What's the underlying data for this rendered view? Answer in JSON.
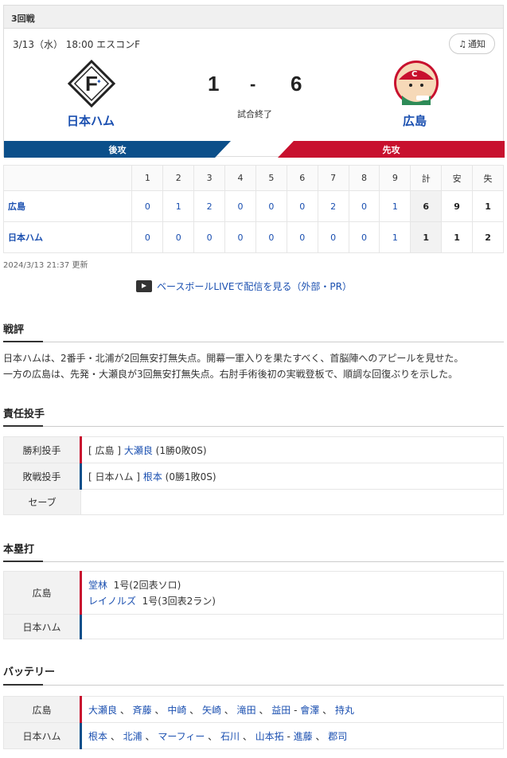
{
  "game": {
    "round": "3回戦",
    "date_venue": "3/13（水） 18:00 エスコンF",
    "notify_label": "通知",
    "home": {
      "name": "日本ハム",
      "score": "1",
      "side": "後攻"
    },
    "away": {
      "name": "広島",
      "score": "6",
      "side": "先攻"
    },
    "dash": "-",
    "status": "試合終了"
  },
  "colors": {
    "home": "#0b4f8a",
    "away": "#c8102e",
    "link": "#1a4fb0"
  },
  "scoreboard": {
    "headers": [
      "1",
      "2",
      "3",
      "4",
      "5",
      "6",
      "7",
      "8",
      "9",
      "計",
      "安",
      "失"
    ],
    "rows": [
      {
        "team": "広島",
        "innings": [
          "0",
          "1",
          "2",
          "0",
          "0",
          "0",
          "2",
          "0",
          "1"
        ],
        "total": "6",
        "hits": "9",
        "errors": "1"
      },
      {
        "team": "日本ハム",
        "innings": [
          "0",
          "0",
          "0",
          "0",
          "0",
          "0",
          "0",
          "0",
          "1"
        ],
        "total": "1",
        "hits": "1",
        "errors": "2"
      }
    ],
    "updated": "2024/3/13 21:37 更新"
  },
  "live_link": "ベースボールLIVEで配信を見る（外部・PR）",
  "review": {
    "title": "戦評",
    "line1": "日本ハムは、2番手・北浦が2回無安打無失点。開幕一軍入りを果たすべく、首脳陣へのアピールを見せた。",
    "line2": "一方の広島は、先発・大瀬良が3回無安打無失点。右肘手術後初の実戦登板で、順調な回復ぶりを示した。"
  },
  "pitchers": {
    "title": "責任投手",
    "win": {
      "label": "勝利投手",
      "team": "[ 広島 ]",
      "name": "大瀬良",
      "record": "(1勝0敗0S)"
    },
    "lose": {
      "label": "敗戦投手",
      "team": "[ 日本ハム ]",
      "name": "根本",
      "record": "(0勝1敗0S)"
    },
    "save": {
      "label": "セーブ"
    }
  },
  "homeruns": {
    "title": "本塁打",
    "away_label": "広島",
    "home_label": "日本ハム",
    "away": [
      {
        "name": "堂林",
        "detail": "1号(2回表ソロ)"
      },
      {
        "name": "レイノルズ",
        "detail": "1号(3回表2ラン)"
      }
    ]
  },
  "battery": {
    "title": "バッテリー",
    "away_label": "広島",
    "away_players": [
      "大瀬良",
      "斉藤",
      "中崎",
      "矢崎",
      "滝田",
      "益田",
      "會澤",
      "持丸"
    ],
    "home_label": "日本ハム",
    "home_players": [
      "根本",
      "北浦",
      "マーフィー",
      "石川",
      "山本拓",
      "進藤",
      "郡司"
    ]
  }
}
